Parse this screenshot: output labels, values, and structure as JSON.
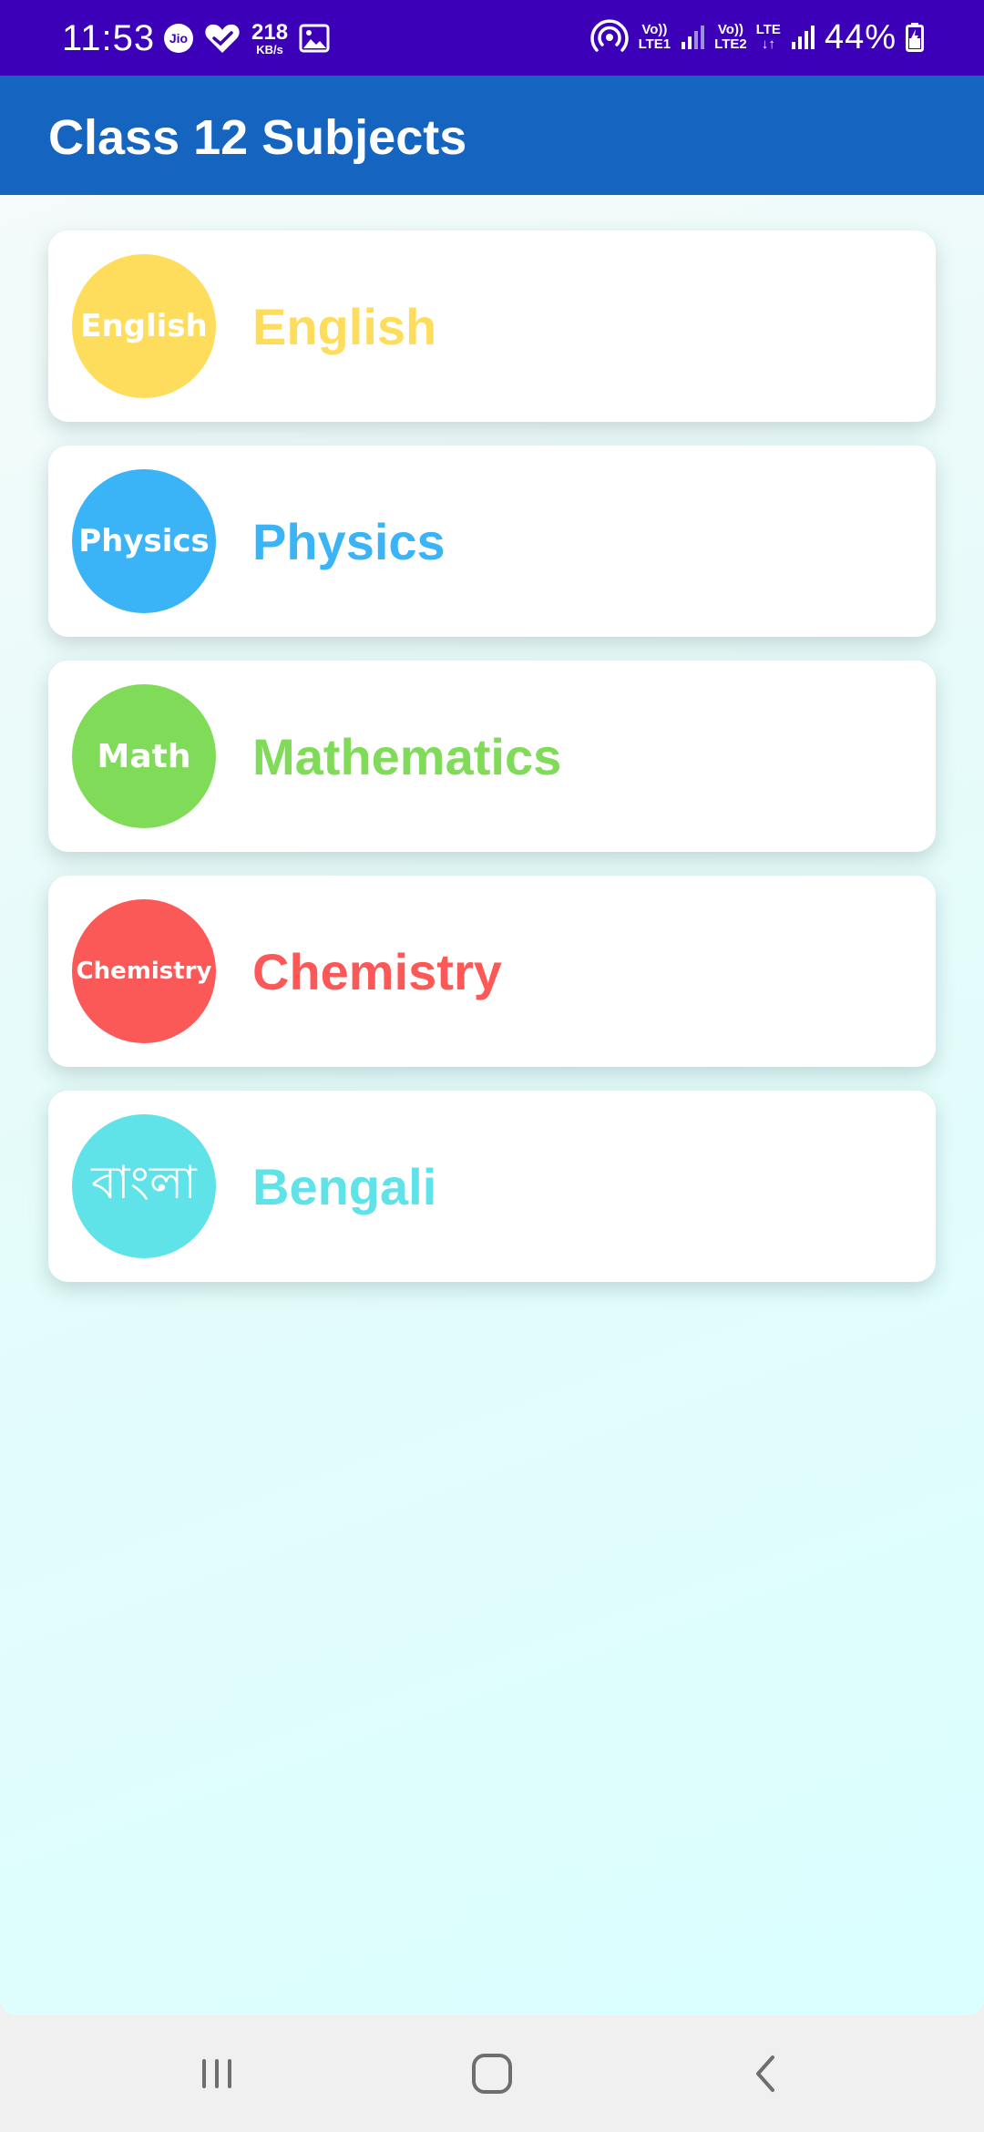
{
  "status_bar": {
    "time": "11:53",
    "jio_label": "Jio",
    "speed_value": "218",
    "speed_unit": "KB/s",
    "net1_top": "Vo))",
    "net1_bottom": "LTE1",
    "net2_top": "Vo))",
    "net2_bottom": "LTE2",
    "lte_label": "LTE",
    "battery": "44%",
    "icons": [
      "jio-icon",
      "heart-check-icon",
      "gallery-icon",
      "hotspot-icon",
      "signal-icon",
      "battery-icon"
    ]
  },
  "app_bar": {
    "title": "Class 12 Subjects",
    "color": "#1565c0"
  },
  "subjects": [
    {
      "badge": "English",
      "label": "English",
      "color": "#ffdd5c"
    },
    {
      "badge": "Physics",
      "label": "Physics",
      "color": "#3ab4f7"
    },
    {
      "badge": "Math",
      "label": "Mathematics",
      "color": "#80db58"
    },
    {
      "badge": "Chemistry",
      "label": "Chemistry",
      "color": "#fb5858"
    },
    {
      "badge": "বাংলা",
      "label": "Bengali",
      "color": "#5fe2e8"
    }
  ],
  "nav_bar": {
    "icons": [
      "recents-icon",
      "home-icon",
      "back-icon"
    ]
  }
}
